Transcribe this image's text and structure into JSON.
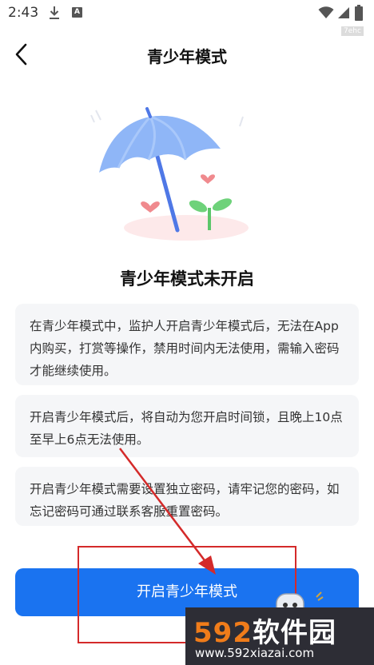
{
  "status_bar": {
    "time": "2:43",
    "a_badge": "A",
    "tag": "7ehc"
  },
  "header": {
    "title": "青少年模式"
  },
  "status_title": "青少年模式未开启",
  "cards": [
    {
      "text": "在青少年模式中，监护人开启青少年模式后，无法在App内购买，打赏等操作，禁用时间内无法使用，需输入密码才能继续使用。"
    },
    {
      "text": "开启青少年模式后，将自动为您开启时间锁，且晚上10点至早上6点无法使用。"
    },
    {
      "text": "开启青少年模式需要设置独立密码，请牢记您的密码，如忘记密码可通过联系客服重置密码。"
    }
  ],
  "cta": {
    "label": "开启青少年模式"
  },
  "watermark": {
    "number": "592",
    "brand": "软件园",
    "url": "www.592xiazai.com"
  },
  "colors": {
    "accent": "#1a73f0",
    "card_bg": "#f5f6f8",
    "annotation": "#d42a2a"
  },
  "icons": [
    "download-icon",
    "a-badge-icon",
    "wifi-icon",
    "signal-icon",
    "battery-icon",
    "back-icon",
    "umbrella-illustration"
  ]
}
